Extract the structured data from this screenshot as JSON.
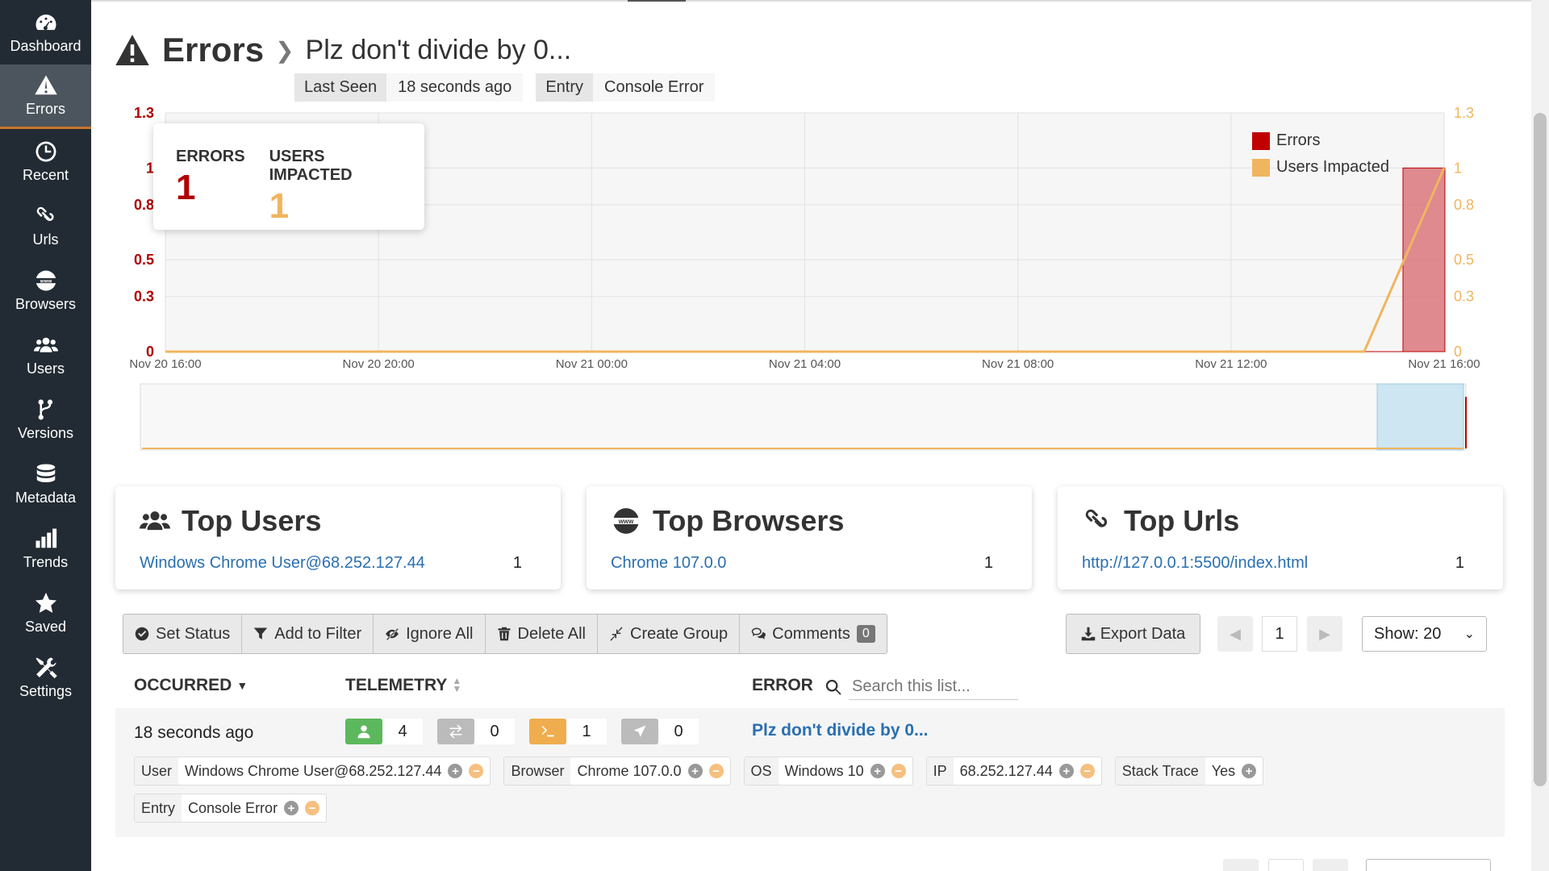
{
  "sidebar": {
    "items": [
      {
        "label": "Dashboard",
        "icon": "dashboard-icon",
        "active": false
      },
      {
        "label": "Errors",
        "icon": "warning-icon",
        "active": true
      },
      {
        "label": "Recent",
        "icon": "clock-icon",
        "active": false
      },
      {
        "label": "Urls",
        "icon": "link-icon",
        "active": false
      },
      {
        "label": "Browsers",
        "icon": "www-icon",
        "active": false
      },
      {
        "label": "Users",
        "icon": "users-icon",
        "active": false
      },
      {
        "label": "Versions",
        "icon": "branch-icon",
        "active": false
      },
      {
        "label": "Metadata",
        "icon": "database-icon",
        "active": false
      },
      {
        "label": "Trends",
        "icon": "bar-chart-icon",
        "active": false
      },
      {
        "label": "Saved",
        "icon": "star-icon",
        "active": false
      },
      {
        "label": "Settings",
        "icon": "tools-icon",
        "active": false
      }
    ]
  },
  "header": {
    "section": "Errors",
    "title": "Plz don't divide by 0...",
    "last_seen_label": "Last Seen",
    "last_seen_value": "18 seconds ago",
    "entry_label": "Entry",
    "entry_value": "Console Error"
  },
  "stats": {
    "errors_label": "ERRORS",
    "errors_value": "1",
    "users_label": "USERS IMPACTED",
    "users_value": "1"
  },
  "chart_data": {
    "type": "bar",
    "x_ticks": [
      "Nov 20 16:00",
      "Nov 20 20:00",
      "Nov 21 00:00",
      "Nov 21 04:00",
      "Nov 21 08:00",
      "Nov 21 12:00",
      "Nov 21 16:00"
    ],
    "y_ticks_left": [
      "0",
      "0.3",
      "0.5",
      "0.8",
      "1",
      "1.3"
    ],
    "y_ticks_right": [
      "0",
      "0.3",
      "0.5",
      "0.8",
      "1",
      "1.3"
    ],
    "ylim": [
      0,
      1.3
    ],
    "series": [
      {
        "name": "Errors",
        "type": "bar",
        "color": "#c00000",
        "points": [
          {
            "x": "Nov 21 15:30",
            "y": 1
          }
        ]
      },
      {
        "name": "Users Impacted",
        "type": "line",
        "color": "#f0b55f",
        "points": [
          {
            "x": "Nov 20 16:00",
            "y": 0
          },
          {
            "x": "Nov 21 14:30",
            "y": 0
          },
          {
            "x": "Nov 21 16:00",
            "y": 1
          }
        ]
      }
    ],
    "legend_position": "top-right",
    "grid": true
  },
  "colors": {
    "errors": "#c00000",
    "users": "#f0b55f",
    "link": "#2a6fb0",
    "sidebar_bg": "#222b33",
    "active_accent": "#c8742b"
  },
  "cards": {
    "users": {
      "title": "Top Users",
      "item": "Windows Chrome User@68.252.127.44",
      "count": "1"
    },
    "browsers": {
      "title": "Top Browsers",
      "item": "Chrome 107.0.0",
      "count": "1"
    },
    "urls": {
      "title": "Top Urls",
      "item": "http://127.0.0.1:5500/index.html",
      "count": "1"
    }
  },
  "toolbar": {
    "set_status": "Set Status",
    "add_filter": "Add to Filter",
    "ignore_all": "Ignore All",
    "delete_all": "Delete All",
    "create_group": "Create Group",
    "comments": "Comments",
    "comments_count": "0",
    "export": "Export Data",
    "page": "1",
    "show": "Show: 20"
  },
  "table": {
    "col_occurred": "OCCURRED",
    "col_telemetry": "TELEMETRY",
    "col_error": "ERROR",
    "search_placeholder": "Search this list...",
    "row": {
      "occurred": "18 seconds ago",
      "telemetry": [
        {
          "icon": "user-icon",
          "color": "#5cb85c",
          "value": "4"
        },
        {
          "icon": "network-icon",
          "color": "#bbbbbb",
          "value": "0"
        },
        {
          "icon": "console-icon",
          "color": "#f0ad4e",
          "value": "1"
        },
        {
          "icon": "navigation-icon",
          "color": "#bbbbbb",
          "value": "0"
        }
      ],
      "error": "Plz don't divide by 0...",
      "tags": [
        {
          "key": "User",
          "value": "Windows Chrome User@68.252.127.44",
          "minus": true
        },
        {
          "key": "Browser",
          "value": "Chrome 107.0.0",
          "minus": true
        },
        {
          "key": "OS",
          "value": "Windows 10",
          "minus": true
        },
        {
          "key": "IP",
          "value": "68.252.127.44",
          "minus": true
        },
        {
          "key": "Stack Trace",
          "value": "Yes",
          "minus": false
        },
        {
          "key": "Entry",
          "value": "Console Error",
          "minus": true
        }
      ]
    }
  }
}
